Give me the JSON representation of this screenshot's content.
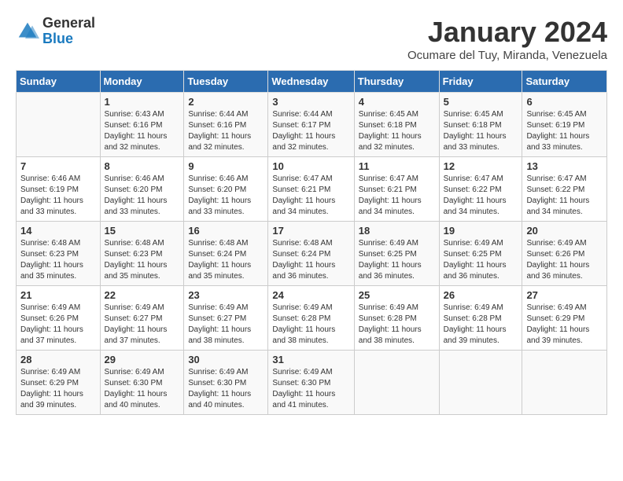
{
  "logo": {
    "general": "General",
    "blue": "Blue"
  },
  "title": "January 2024",
  "subtitle": "Ocumare del Tuy, Miranda, Venezuela",
  "days_of_week": [
    "Sunday",
    "Monday",
    "Tuesday",
    "Wednesday",
    "Thursday",
    "Friday",
    "Saturday"
  ],
  "weeks": [
    [
      {
        "day": "",
        "sunrise": "",
        "sunset": "",
        "daylight": ""
      },
      {
        "day": "1",
        "sunrise": "Sunrise: 6:43 AM",
        "sunset": "Sunset: 6:16 PM",
        "daylight": "Daylight: 11 hours and 32 minutes."
      },
      {
        "day": "2",
        "sunrise": "Sunrise: 6:44 AM",
        "sunset": "Sunset: 6:16 PM",
        "daylight": "Daylight: 11 hours and 32 minutes."
      },
      {
        "day": "3",
        "sunrise": "Sunrise: 6:44 AM",
        "sunset": "Sunset: 6:17 PM",
        "daylight": "Daylight: 11 hours and 32 minutes."
      },
      {
        "day": "4",
        "sunrise": "Sunrise: 6:45 AM",
        "sunset": "Sunset: 6:18 PM",
        "daylight": "Daylight: 11 hours and 32 minutes."
      },
      {
        "day": "5",
        "sunrise": "Sunrise: 6:45 AM",
        "sunset": "Sunset: 6:18 PM",
        "daylight": "Daylight: 11 hours and 33 minutes."
      },
      {
        "day": "6",
        "sunrise": "Sunrise: 6:45 AM",
        "sunset": "Sunset: 6:19 PM",
        "daylight": "Daylight: 11 hours and 33 minutes."
      }
    ],
    [
      {
        "day": "7",
        "sunrise": "Sunrise: 6:46 AM",
        "sunset": "Sunset: 6:19 PM",
        "daylight": "Daylight: 11 hours and 33 minutes."
      },
      {
        "day": "8",
        "sunrise": "Sunrise: 6:46 AM",
        "sunset": "Sunset: 6:20 PM",
        "daylight": "Daylight: 11 hours and 33 minutes."
      },
      {
        "day": "9",
        "sunrise": "Sunrise: 6:46 AM",
        "sunset": "Sunset: 6:20 PM",
        "daylight": "Daylight: 11 hours and 33 minutes."
      },
      {
        "day": "10",
        "sunrise": "Sunrise: 6:47 AM",
        "sunset": "Sunset: 6:21 PM",
        "daylight": "Daylight: 11 hours and 34 minutes."
      },
      {
        "day": "11",
        "sunrise": "Sunrise: 6:47 AM",
        "sunset": "Sunset: 6:21 PM",
        "daylight": "Daylight: 11 hours and 34 minutes."
      },
      {
        "day": "12",
        "sunrise": "Sunrise: 6:47 AM",
        "sunset": "Sunset: 6:22 PM",
        "daylight": "Daylight: 11 hours and 34 minutes."
      },
      {
        "day": "13",
        "sunrise": "Sunrise: 6:47 AM",
        "sunset": "Sunset: 6:22 PM",
        "daylight": "Daylight: 11 hours and 34 minutes."
      }
    ],
    [
      {
        "day": "14",
        "sunrise": "Sunrise: 6:48 AM",
        "sunset": "Sunset: 6:23 PM",
        "daylight": "Daylight: 11 hours and 35 minutes."
      },
      {
        "day": "15",
        "sunrise": "Sunrise: 6:48 AM",
        "sunset": "Sunset: 6:23 PM",
        "daylight": "Daylight: 11 hours and 35 minutes."
      },
      {
        "day": "16",
        "sunrise": "Sunrise: 6:48 AM",
        "sunset": "Sunset: 6:24 PM",
        "daylight": "Daylight: 11 hours and 35 minutes."
      },
      {
        "day": "17",
        "sunrise": "Sunrise: 6:48 AM",
        "sunset": "Sunset: 6:24 PM",
        "daylight": "Daylight: 11 hours and 36 minutes."
      },
      {
        "day": "18",
        "sunrise": "Sunrise: 6:49 AM",
        "sunset": "Sunset: 6:25 PM",
        "daylight": "Daylight: 11 hours and 36 minutes."
      },
      {
        "day": "19",
        "sunrise": "Sunrise: 6:49 AM",
        "sunset": "Sunset: 6:25 PM",
        "daylight": "Daylight: 11 hours and 36 minutes."
      },
      {
        "day": "20",
        "sunrise": "Sunrise: 6:49 AM",
        "sunset": "Sunset: 6:26 PM",
        "daylight": "Daylight: 11 hours and 36 minutes."
      }
    ],
    [
      {
        "day": "21",
        "sunrise": "Sunrise: 6:49 AM",
        "sunset": "Sunset: 6:26 PM",
        "daylight": "Daylight: 11 hours and 37 minutes."
      },
      {
        "day": "22",
        "sunrise": "Sunrise: 6:49 AM",
        "sunset": "Sunset: 6:27 PM",
        "daylight": "Daylight: 11 hours and 37 minutes."
      },
      {
        "day": "23",
        "sunrise": "Sunrise: 6:49 AM",
        "sunset": "Sunset: 6:27 PM",
        "daylight": "Daylight: 11 hours and 38 minutes."
      },
      {
        "day": "24",
        "sunrise": "Sunrise: 6:49 AM",
        "sunset": "Sunset: 6:28 PM",
        "daylight": "Daylight: 11 hours and 38 minutes."
      },
      {
        "day": "25",
        "sunrise": "Sunrise: 6:49 AM",
        "sunset": "Sunset: 6:28 PM",
        "daylight": "Daylight: 11 hours and 38 minutes."
      },
      {
        "day": "26",
        "sunrise": "Sunrise: 6:49 AM",
        "sunset": "Sunset: 6:28 PM",
        "daylight": "Daylight: 11 hours and 39 minutes."
      },
      {
        "day": "27",
        "sunrise": "Sunrise: 6:49 AM",
        "sunset": "Sunset: 6:29 PM",
        "daylight": "Daylight: 11 hours and 39 minutes."
      }
    ],
    [
      {
        "day": "28",
        "sunrise": "Sunrise: 6:49 AM",
        "sunset": "Sunset: 6:29 PM",
        "daylight": "Daylight: 11 hours and 39 minutes."
      },
      {
        "day": "29",
        "sunrise": "Sunrise: 6:49 AM",
        "sunset": "Sunset: 6:30 PM",
        "daylight": "Daylight: 11 hours and 40 minutes."
      },
      {
        "day": "30",
        "sunrise": "Sunrise: 6:49 AM",
        "sunset": "Sunset: 6:30 PM",
        "daylight": "Daylight: 11 hours and 40 minutes."
      },
      {
        "day": "31",
        "sunrise": "Sunrise: 6:49 AM",
        "sunset": "Sunset: 6:30 PM",
        "daylight": "Daylight: 11 hours and 41 minutes."
      },
      {
        "day": "",
        "sunrise": "",
        "sunset": "",
        "daylight": ""
      },
      {
        "day": "",
        "sunrise": "",
        "sunset": "",
        "daylight": ""
      },
      {
        "day": "",
        "sunrise": "",
        "sunset": "",
        "daylight": ""
      }
    ]
  ]
}
